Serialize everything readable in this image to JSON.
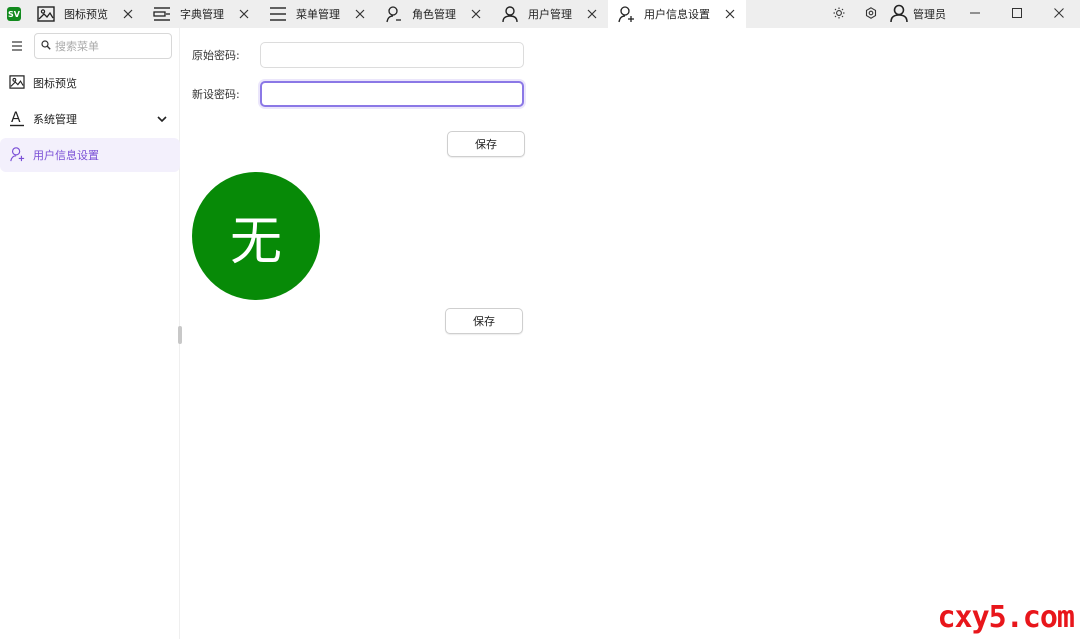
{
  "app": {
    "logo_text": "SV"
  },
  "tabs": [
    {
      "label": "图标预览",
      "icon": "image-icon"
    },
    {
      "label": "字典管理",
      "icon": "dictionary-icon"
    },
    {
      "label": "菜单管理",
      "icon": "menu-list-icon"
    },
    {
      "label": "角色管理",
      "icon": "user-role-icon"
    },
    {
      "label": "用户管理",
      "icon": "user-icon"
    },
    {
      "label": "用户信息设置",
      "icon": "user-settings-icon",
      "active": true
    }
  ],
  "header": {
    "user_name": "管理员"
  },
  "sidebar": {
    "search_placeholder": "搜索菜单",
    "items": [
      {
        "label": "图标预览",
        "icon": "image-icon"
      },
      {
        "label": "系统管理",
        "icon": "font-a-icon",
        "expandable": true
      },
      {
        "label": "用户信息设置",
        "icon": "user-settings-icon",
        "active": true
      }
    ]
  },
  "form": {
    "old_password_label": "原始密码:",
    "old_password_value": "",
    "new_password_label": "新设密码:",
    "new_password_value": "",
    "save_label": "保存"
  },
  "avatar": {
    "text": "无",
    "color": "#078a07"
  },
  "avatar_save_label": "保存",
  "watermark": "cxy5.com",
  "colors": {
    "accent": "#7a4fd6",
    "active_bg": "#f3f0fc",
    "logo": "#128a1e"
  }
}
